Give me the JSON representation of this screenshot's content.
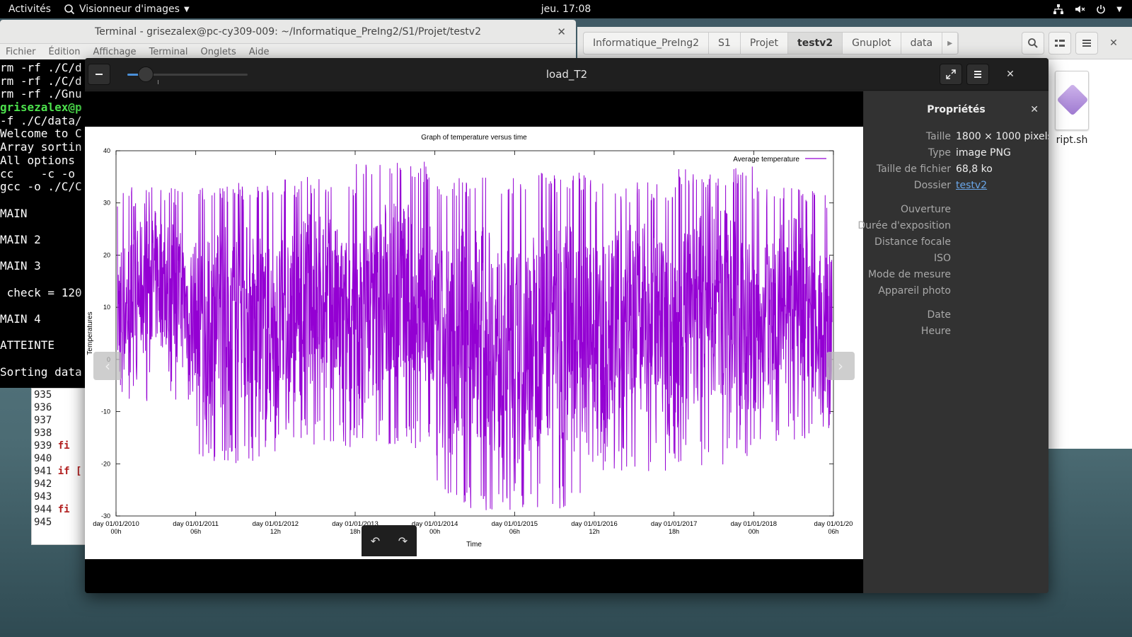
{
  "topbar": {
    "activities": "Activités",
    "app_name": "Visionneur d'images",
    "clock": "jeu. 17:08"
  },
  "terminal": {
    "title": "Terminal - grisezalex@pc-cy309-009: ~/Informatique_PreIng2/S1/Projet/testv2",
    "menu": [
      "Fichier",
      "Édition",
      "Affichage",
      "Terminal",
      "Onglets",
      "Aide"
    ],
    "lines": [
      {
        "text": "rm -rf ./C/d",
        "style": "normal"
      },
      {
        "text": "rm -rf ./C/d",
        "style": "normal"
      },
      {
        "text": "rm -rf ./Gnu",
        "style": "normal"
      },
      {
        "text": "grisezalex@p",
        "style": "green"
      },
      {
        "text": "-f ./C/data/",
        "style": "normal"
      },
      {
        "text": "Welcome to C",
        "style": "normal"
      },
      {
        "text": "Array sortin",
        "style": "normal"
      },
      {
        "text": "All options",
        "style": "normal"
      },
      {
        "text": "cc    -c -o",
        "style": "normal"
      },
      {
        "text": "gcc -o ./C/C",
        "style": "normal"
      },
      {
        "text": "",
        "style": "normal"
      },
      {
        "text": "MAIN",
        "style": "normal"
      },
      {
        "text": "",
        "style": "normal"
      },
      {
        "text": "MAIN 2",
        "style": "normal"
      },
      {
        "text": "",
        "style": "normal"
      },
      {
        "text": "MAIN 3",
        "style": "normal"
      },
      {
        "text": "",
        "style": "normal"
      },
      {
        "text": " check = 120",
        "style": "normal"
      },
      {
        "text": "",
        "style": "normal"
      },
      {
        "text": "MAIN 4",
        "style": "normal"
      },
      {
        "text": "",
        "style": "normal"
      },
      {
        "text": "ATTEINTE",
        "style": "normal"
      },
      {
        "text": "",
        "style": "normal"
      },
      {
        "text": "Sorting data",
        "style": "normal"
      }
    ]
  },
  "editor": {
    "lines": [
      {
        "num": "935",
        "code": ""
      },
      {
        "num": "936",
        "code": ""
      },
      {
        "num": "937",
        "code": ""
      },
      {
        "num": "938",
        "code": ""
      },
      {
        "num": "939",
        "code": "fi"
      },
      {
        "num": "940",
        "code": ""
      },
      {
        "num": "941",
        "code": "if ["
      },
      {
        "num": "942",
        "code": ""
      },
      {
        "num": "943",
        "code": ""
      },
      {
        "num": "944",
        "code": "fi"
      },
      {
        "num": "945",
        "code": ""
      }
    ]
  },
  "files": {
    "breadcrumbs": [
      "Informatique_PreIng2",
      "S1",
      "Projet",
      "testv2",
      "Gnuplot",
      "data"
    ],
    "active_crumb": "testv2",
    "file_name": "ript.sh"
  },
  "viewer": {
    "title": "load_T2",
    "zoom_level": 0.15,
    "properties": {
      "heading": "Propriétés",
      "rows": [
        {
          "key": "Taille",
          "value": "1800 × 1000 pixels"
        },
        {
          "key": "Type",
          "value": "image PNG"
        },
        {
          "key": "Taille de fichier",
          "value": "68,8 ko"
        },
        {
          "key": "Dossier",
          "value": "testv2",
          "link": true
        },
        {
          "key": "Ouverture",
          "value": ""
        },
        {
          "key": "Durée d'exposition",
          "value": ""
        },
        {
          "key": "Distance focale",
          "value": ""
        },
        {
          "key": "ISO",
          "value": ""
        },
        {
          "key": "Mode de mesure",
          "value": ""
        },
        {
          "key": "Appareil photo",
          "value": ""
        },
        {
          "key": "Date",
          "value": ""
        },
        {
          "key": "Heure",
          "value": ""
        }
      ]
    }
  },
  "chart_data": {
    "type": "line",
    "title": "Graph of temperature versus time",
    "xlabel": "Time",
    "ylabel": "Temperatures",
    "ylim": [
      -30,
      40
    ],
    "yticks": [
      -30,
      -20,
      -10,
      0,
      10,
      20,
      30,
      40
    ],
    "xticks": [
      {
        "label": "day 01/01/2010",
        "sub": "00h"
      },
      {
        "label": "day 01/01/2011",
        "sub": "06h"
      },
      {
        "label": "day 01/01/2012",
        "sub": "12h"
      },
      {
        "label": "day 01/01/2013",
        "sub": "18h"
      },
      {
        "label": "day 01/01/2014",
        "sub": "00h"
      },
      {
        "label": "day 01/01/2015",
        "sub": "06h"
      },
      {
        "label": "day 01/01/2016",
        "sub": "12h"
      },
      {
        "label": "day 01/01/2017",
        "sub": "18h"
      },
      {
        "label": "day 01/01/2018",
        "sub": "00h"
      },
      {
        "label": "day 01/01/20",
        "sub": "06h"
      }
    ],
    "series": [
      {
        "name": "Average temperature",
        "color": "#9400d3",
        "approx_range_by_period": [
          {
            "period": "2010",
            "min": -8,
            "max": 33
          },
          {
            "period": "2011",
            "min": -20,
            "max": 34
          },
          {
            "period": "2012",
            "min": -17,
            "max": 35
          },
          {
            "period": "2013",
            "min": -17,
            "max": 38
          },
          {
            "period": "2014",
            "min": -29,
            "max": 35
          },
          {
            "period": "2015",
            "min": -29,
            "max": 36
          },
          {
            "period": "2016",
            "min": -22,
            "max": 34
          },
          {
            "period": "2017",
            "min": -21,
            "max": 37
          },
          {
            "period": "2018",
            "min": -16,
            "max": 33
          }
        ]
      }
    ],
    "legend_position": "top-right",
    "grid": false
  }
}
